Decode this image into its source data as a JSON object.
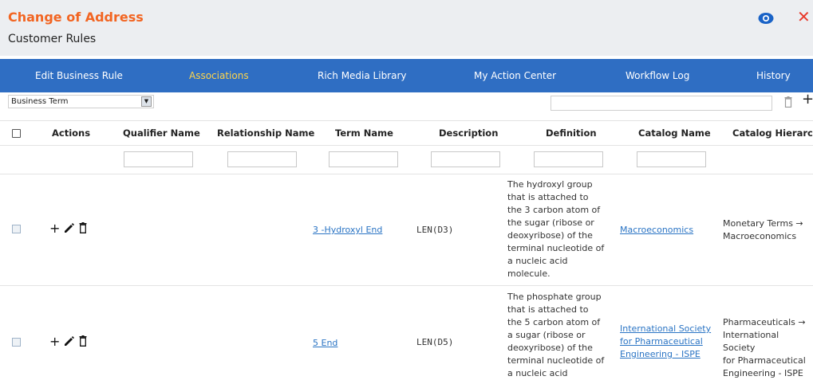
{
  "header": {
    "title": "Change of Address",
    "subtitle": "Customer Rules"
  },
  "tabs": [
    {
      "label": "Edit Business Rule",
      "active": false
    },
    {
      "label": "Associations",
      "active": true
    },
    {
      "label": "Rich Media Library",
      "active": false
    },
    {
      "label": "My Action Center",
      "active": false
    },
    {
      "label": "Workflow Log",
      "active": false
    },
    {
      "label": "History",
      "active": false
    }
  ],
  "toolbar": {
    "type_select_value": "Business Term",
    "search_value": ""
  },
  "table": {
    "columns": [
      "Actions",
      "Qualifier Name",
      "Relationship Name",
      "Term Name",
      "Description",
      "Definition",
      "Catalog Name",
      "Catalog Hierarchy"
    ],
    "rows": [
      {
        "term_name": "3 -Hydroxyl End",
        "description": "LEN(D3)",
        "definition": [
          "The hydroxyl group",
          "that is attached to",
          "the 3 carbon atom of",
          "the sugar (ribose or",
          "deoxyribose) of the",
          "terminal nucleotide of",
          "a nucleic acid",
          "molecule."
        ],
        "catalog_name": [
          "Macroeconomics"
        ],
        "catalog_hierarchy": [
          "Monetary Terms →",
          "Macroeconomics"
        ]
      },
      {
        "term_name": "5 End",
        "description": "LEN(D5)",
        "definition": [
          "The phosphate group",
          "that is attached to",
          "the 5 carbon atom of",
          "a sugar (ribose or",
          "deoxyribose) of the",
          "terminal nucleotide of",
          "a nucleic acid"
        ],
        "catalog_name": [
          "International Society",
          "for Pharmaceutical",
          "Engineering - ISPE"
        ],
        "catalog_hierarchy": [
          "Pharmaceuticals →",
          "International Society",
          "for Pharmaceutical",
          "Engineering - ISPE"
        ]
      }
    ]
  },
  "colors": {
    "title": "#f26522",
    "tab_bar": "#2f6ec3",
    "active_tab": "#ffd54a",
    "link": "#2a74c4",
    "close": "#e8392b",
    "eye": "#1a63c7"
  },
  "icons": {
    "view": "eye-icon",
    "close": "close-icon",
    "delete": "trash-icon",
    "add": "plus-icon",
    "edit": "pencil-icon",
    "dropdown": "chevron-down-icon"
  }
}
